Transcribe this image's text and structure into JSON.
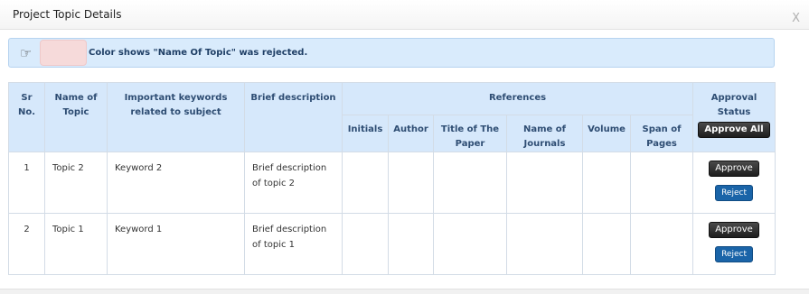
{
  "dialog": {
    "title": "Project Topic Details",
    "close_label": "X"
  },
  "legend": {
    "icon": "pointing-hand-icon",
    "swatch_color": "#f6dada",
    "text": "Color shows \"Name Of Topic\" was rejected."
  },
  "table": {
    "headers": {
      "sr": "Sr No.",
      "name": "Name of Topic",
      "keywords": "Important keywords related to subject",
      "brief": "Brief description",
      "references": "References",
      "approval": "Approval Status",
      "approve_all": "Approve All"
    },
    "ref_headers": [
      "Initials",
      "Author",
      "Title of The Paper",
      "Name of Journals",
      "Volume",
      "Span of Pages"
    ],
    "rows": [
      {
        "sr": "1",
        "name": "Topic 2",
        "keywords": "Keyword 2",
        "brief": "Brief description of topic 2",
        "approve": "Approve",
        "reject": "Reject"
      },
      {
        "sr": "2",
        "name": "Topic 1",
        "keywords": "Keyword 1",
        "brief": "Brief description of topic 1",
        "approve": "Approve",
        "reject": "Reject"
      }
    ]
  }
}
